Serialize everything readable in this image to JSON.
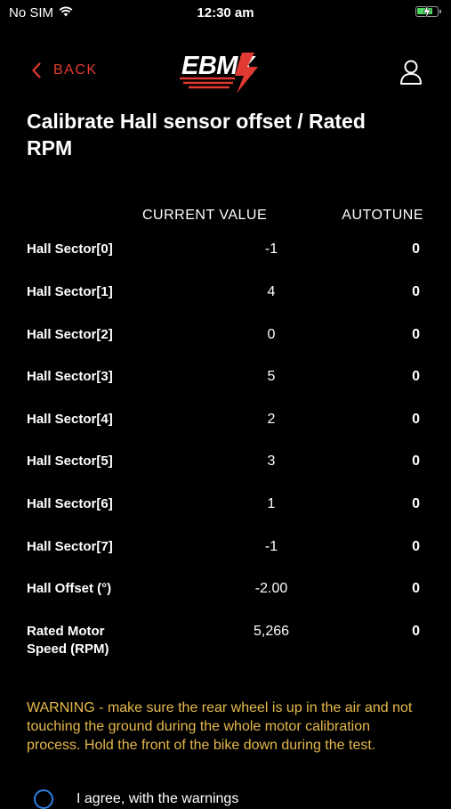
{
  "status_bar": {
    "carrier": "No SIM",
    "time": "12:30 am",
    "battery_level": 0.85
  },
  "nav": {
    "back_label": "BACK",
    "logo_text": "EBMX",
    "accent_color": "#e03a32"
  },
  "page": {
    "title": "Calibrate Hall sensor offset / Rated RPM"
  },
  "table": {
    "headers": {
      "current_value": "CURRENT VALUE",
      "autotune": "AUTOTUNE"
    },
    "rows": [
      {
        "label": "Hall Sector[0]",
        "current": "-1",
        "autotune": "0"
      },
      {
        "label": "Hall Sector[1]",
        "current": "4",
        "autotune": "0"
      },
      {
        "label": "Hall Sector[2]",
        "current": "0",
        "autotune": "0"
      },
      {
        "label": "Hall Sector[3]",
        "current": "5",
        "autotune": "0"
      },
      {
        "label": "Hall Sector[4]",
        "current": "2",
        "autotune": "0"
      },
      {
        "label": "Hall Sector[5]",
        "current": "3",
        "autotune": "0"
      },
      {
        "label": "Hall Sector[6]",
        "current": "1",
        "autotune": "0"
      },
      {
        "label": "Hall Sector[7]",
        "current": "-1",
        "autotune": "0"
      },
      {
        "label": "Hall Offset (°)",
        "current": "-2.00",
        "autotune": "0"
      },
      {
        "label": "Rated Motor Speed (RPM)",
        "current": "5,266",
        "autotune": "0"
      }
    ]
  },
  "warning": {
    "text": "WARNING - make sure the rear wheel is up in the air and not touching the ground during the whole motor calibration process. Hold the front of the bike down during the test.",
    "color": "#e6b94a"
  },
  "agreement": {
    "label": "I agree, with the warnings",
    "checked": false
  }
}
